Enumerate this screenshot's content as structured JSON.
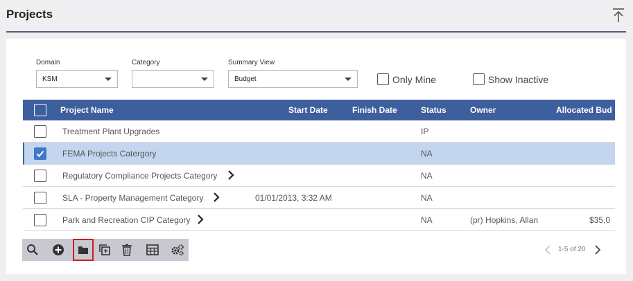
{
  "header": {
    "title": "Projects"
  },
  "filters": {
    "domain": {
      "label": "Domain",
      "value": "KSM"
    },
    "category": {
      "label": "Category",
      "value": ""
    },
    "summary_view": {
      "label": "Summary View",
      "value": "Budget"
    },
    "only_mine": {
      "label": "Only Mine",
      "checked": false
    },
    "show_inactive": {
      "label": "Show Inactive",
      "checked": false
    }
  },
  "table": {
    "columns": [
      "Project Name",
      "Start Date",
      "Finish Date",
      "Status",
      "Owner",
      "Allocated Bud"
    ],
    "rows": [
      {
        "name": "Treatment Plant Upgrades",
        "start": "",
        "finish": "",
        "status": "IP",
        "owner": "",
        "budget": "",
        "checked": false,
        "has_children": false
      },
      {
        "name": "FEMA Projects Catergory",
        "start": "",
        "finish": "",
        "status": "NA",
        "owner": "",
        "budget": "",
        "checked": true,
        "has_children": false
      },
      {
        "name": "Regulatory Compliance Projects Category",
        "start": "",
        "finish": "",
        "status": "NA",
        "owner": "",
        "budget": "",
        "checked": false,
        "has_children": true
      },
      {
        "name": "SLA - Property Management Category",
        "start": "01/01/2013, 3:32 AM",
        "finish": "",
        "status": "NA",
        "owner": "",
        "budget": "",
        "checked": false,
        "has_children": true
      },
      {
        "name": "Park and Recreation CIP Category",
        "start": "",
        "finish": "",
        "status": "NA",
        "owner": "(pr) Hopkins, Allan",
        "budget": "$35,0",
        "checked": false,
        "has_children": true
      }
    ]
  },
  "toolbar": {
    "buttons": [
      "search-icon",
      "add-icon",
      "folder-icon",
      "copy-icon",
      "trash-icon",
      "table-icon",
      "settings-icon"
    ],
    "active": "folder-icon"
  },
  "pager": {
    "info": "1-5 of 20"
  },
  "colors": {
    "header_bg": "#3e5f9e",
    "selected_row": "#c4d6ef",
    "toolbar_bg": "#c8c9d0",
    "active_outline": "#cc1f1f"
  }
}
